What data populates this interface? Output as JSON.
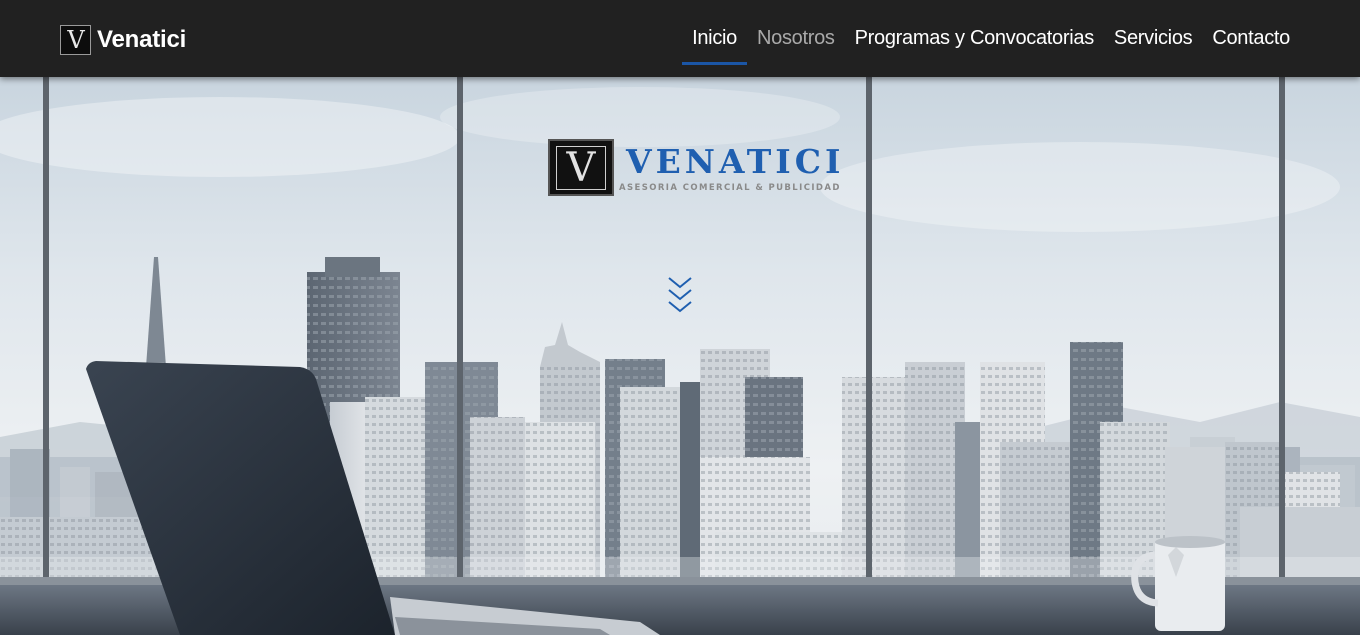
{
  "brand": {
    "logo_glyph": "V",
    "name": "Venatici"
  },
  "nav": {
    "items": [
      {
        "label": "Inicio",
        "state": "active"
      },
      {
        "label": "Nosotros",
        "state": "muted"
      },
      {
        "label": "Programas y Convocatorias",
        "state": "normal"
      },
      {
        "label": "Servicios",
        "state": "normal"
      },
      {
        "label": "Contacto",
        "state": "normal"
      }
    ]
  },
  "hero": {
    "logo_glyph": "V",
    "logo_name": "VENATICI",
    "logo_tagline": "ASESORIA COMERCIAL & PUBLICIDAD",
    "scroll_icon": "chevrons-down-icon",
    "background": "office-window-city-skyline-with-laptop-and-mug"
  },
  "colors": {
    "navbar_bg": "#212121",
    "accent": "#1b56a6",
    "logo_blue": "#1f5fb0",
    "nav_text": "#ffffff",
    "nav_muted": "#a9a9a9"
  }
}
